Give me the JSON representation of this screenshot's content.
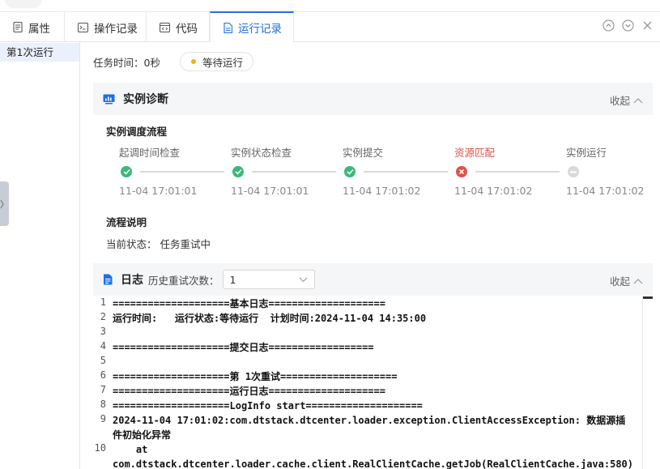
{
  "tabs": [
    {
      "label": "属性",
      "icon": "document-icon",
      "active": false
    },
    {
      "label": "操作记录",
      "icon": "terminal-icon",
      "active": false
    },
    {
      "label": "代码",
      "icon": "code-icon",
      "active": false
    },
    {
      "label": "运行记录",
      "icon": "file-icon",
      "active": true
    }
  ],
  "sidebar": {
    "items": [
      {
        "label": "第1次运行"
      }
    ]
  },
  "task": {
    "time_label": "任务时间：0秒",
    "status": "等待运行",
    "status_color": "#f0b400"
  },
  "diagnosis": {
    "title": "实例诊断",
    "collapse_label": "收起",
    "flow_title": "实例调度流程",
    "steps": [
      {
        "name": "起调时间检查",
        "time": "11-04 17:01:01",
        "state": "success"
      },
      {
        "name": "实例状态检查",
        "time": "11-04 17:01:01",
        "state": "success"
      },
      {
        "name": "实例提交",
        "time": "11-04 17:01:02",
        "state": "success"
      },
      {
        "name": "资源匹配",
        "time": "11-04 17:01:02",
        "state": "error"
      },
      {
        "name": "实例运行",
        "time": "11-04 17:01:02",
        "state": "pending"
      }
    ],
    "desc_title": "流程说明",
    "current_status": "当前状态：  任务重试中"
  },
  "log": {
    "title": "日志",
    "retry_label": "历史重试次数：",
    "retry_value": "1",
    "collapse_label": "收起",
    "lines": [
      {
        "n": "1",
        "text": "====================基本日志===================="
      },
      {
        "n": "2",
        "text": "运行时间:   运行状态:等待运行  计划时间:2024-11-04 14:35:00"
      },
      {
        "n": "3",
        "text": ""
      },
      {
        "n": "4",
        "text": "====================提交日志=================="
      },
      {
        "n": "5",
        "text": ""
      },
      {
        "n": "6",
        "text": "====================第 1次重试===================="
      },
      {
        "n": "7",
        "text": "====================运行日志===================="
      },
      {
        "n": "8",
        "text": "====================LogInfo start===================="
      },
      {
        "n": "9",
        "text": "2024-11-04 17:01:02:com.dtstack.dtcenter.loader.exception.ClientAccessException: 数据源插件初始化异常"
      },
      {
        "n": "10",
        "text": "    at com.dtstack.dtcenter.loader.cache.client.RealClientCache.getJob(RealClientCache.java:580)"
      }
    ]
  },
  "colors": {
    "accent": "#1f6fe6",
    "success": "#3bb97a",
    "error": "#e0504a",
    "pending": "#d9d9d9"
  }
}
